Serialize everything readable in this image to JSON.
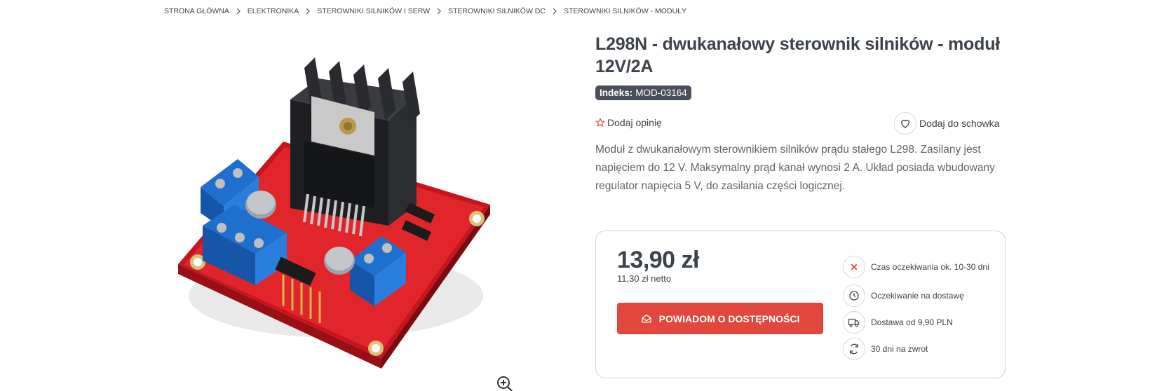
{
  "breadcrumb": [
    {
      "label": "STRONA GŁÓWNA"
    },
    {
      "label": "ELEKTRONIKA"
    },
    {
      "label": "STEROWNIKI SILNIKÓW I SERW"
    },
    {
      "label": "STEROWNIKI SILNIKÓW DC"
    },
    {
      "label": "STEROWNIKI SILNIKÓW - MODUŁY"
    }
  ],
  "product": {
    "title": "L298N - dwukanałowy sterownik silników - moduł 12V/2A",
    "sku_label": "Indeks:",
    "sku_value": "MOD-03164",
    "review_label": "Dodaj opinię",
    "wishlist_label": "Dodaj do schowka",
    "description": "Moduł z dwukanałowym sterownikiem silników prądu stałego L298. Zasilany jest napięciem do 12 V. Maksymalny prąd kanał wynosi 2 A. Układ posiada wbudowany regulator napięcia 5 V, do zasilania części logicznej.",
    "image_icon": "zoom-in-icon"
  },
  "buybox": {
    "price": "13,90 zł",
    "net_price": "11,30 zł netto",
    "notify_label": "POWIADOM O DOSTĘPNOŚCI",
    "features": [
      {
        "icon": "x-icon",
        "text": "Czas oczekiwania ok. 10-30 dni"
      },
      {
        "icon": "clock-icon",
        "text": "Oczekiwanie na dostawę"
      },
      {
        "icon": "truck-icon",
        "text": "Dostawa od 9,90 PLN"
      },
      {
        "icon": "refresh-icon",
        "text": "30 dni na zwrot"
      }
    ]
  },
  "colors": {
    "accent": "#e1473d",
    "text": "#3c434a",
    "badge": "#4a5059",
    "border": "#cfd2d6"
  }
}
